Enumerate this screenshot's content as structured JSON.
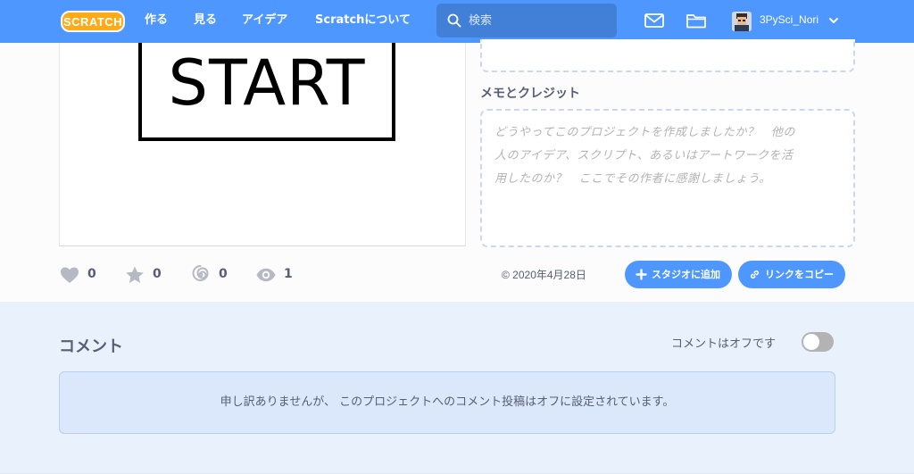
{
  "nav": {
    "logo_text": "SCRATCH",
    "links": [
      "作る",
      "見る",
      "アイデア",
      "Scratchについて"
    ],
    "search_placeholder": "検索",
    "username": "3PySci_Nori"
  },
  "colors": {
    "nav_bg": "#4d97ff",
    "comment_bg": "#e9f1fc",
    "button_bg": "#4d97ff",
    "notice_bg": "#dbe7fb"
  },
  "stage": {
    "start_text": "START"
  },
  "credits": {
    "title": "メモとクレジット",
    "placeholder_lines": [
      "どうやってこのプロジェクトを作成しましたか？　他の",
      "人のアイデア、スクリプト、あるいはアートワークを活",
      "用したのか？　ここでその作者に感謝しましょう。"
    ]
  },
  "stats": {
    "loves": "0",
    "favorites": "0",
    "remixes": "0",
    "views": "1"
  },
  "share": {
    "date": "© 2020年4月28日",
    "add_to_studio_label": "スタジオに追加",
    "copy_link_label": "リンクをコピー"
  },
  "comments": {
    "title": "コメント",
    "off_label": "コメントはオフです",
    "notice": "申し訳ありませんが、 このプロジェクトへのコメント投稿はオフに設定されています。",
    "toggle_on": false
  }
}
